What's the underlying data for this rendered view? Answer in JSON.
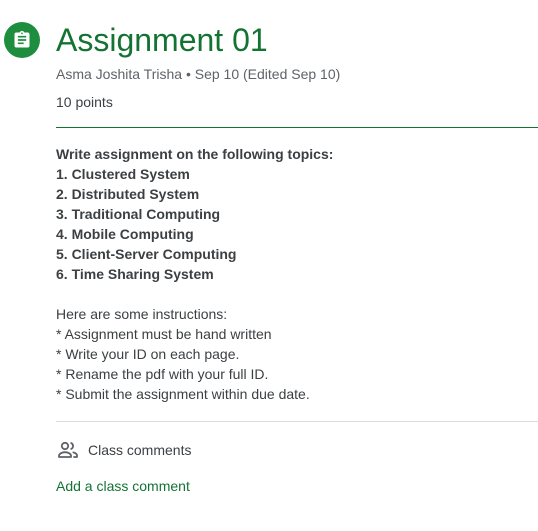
{
  "header": {
    "icon": "assignment-clipboard-icon",
    "title": "Assignment 01",
    "meta": "Asma Joshita Trisha • Sep 10 (Edited Sep 10)",
    "points": "10 points"
  },
  "description": {
    "intro": "Write assignment on the following topics:",
    "topics": [
      "1. Clustered System",
      "2. Distributed System",
      "3. Traditional Computing",
      "4. Mobile Computing",
      "5. Client-Server Computing",
      "6. Time Sharing System"
    ],
    "instructions_heading": "Here are some instructions:",
    "instructions": [
      "* Assignment must be hand written",
      "* Write your ID on each page.",
      "* Rename the pdf with your full ID.",
      "* Submit the assignment within due date."
    ]
  },
  "comments": {
    "icon": "people-icon",
    "label": "Class comments",
    "add_label": "Add a class comment"
  },
  "colors": {
    "accent_green": "#137333",
    "icon_green": "#1e8e3e",
    "text": "#3c4043",
    "muted": "#5f6368",
    "divider": "#dadce0"
  }
}
